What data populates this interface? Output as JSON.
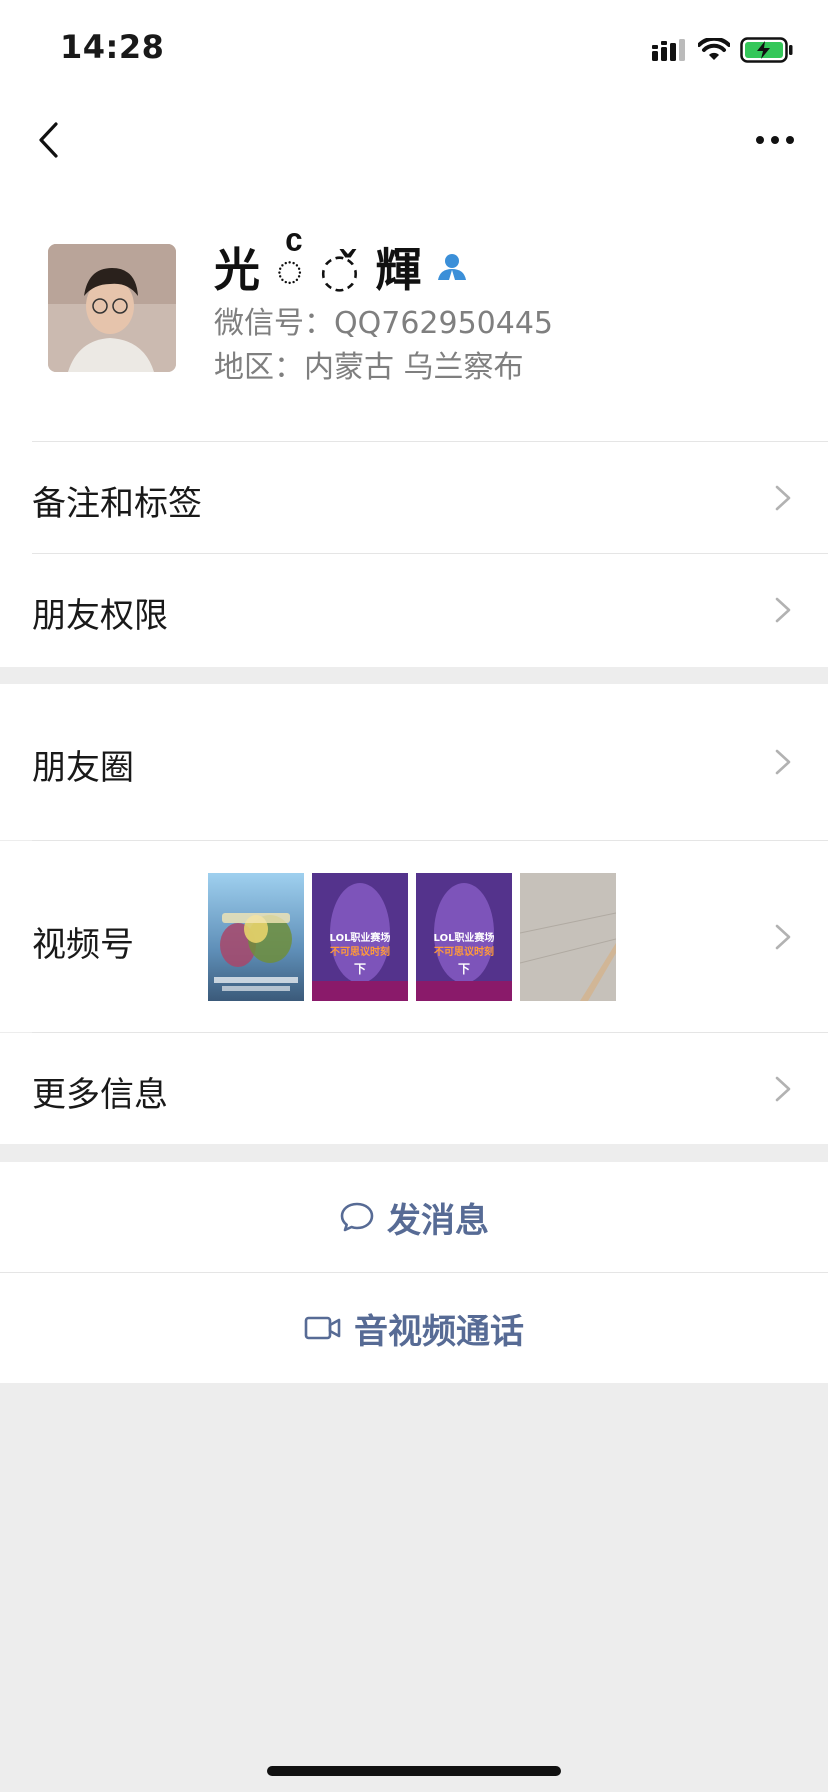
{
  "status_bar": {
    "time": "14:28",
    "battery": "charging"
  },
  "profile": {
    "name": "光 ◌ͨ ◌̌ 輝",
    "wechat_id": "微信号：QQ762950445",
    "region": "地区：内蒙古 乌兰察布"
  },
  "menu": {
    "remark_tags": "备注和标签",
    "friend_permission": "朋友权限",
    "moments": "朋友圈",
    "channels": "视频号",
    "more_info": "更多信息"
  },
  "actions": {
    "send_message": "发消息",
    "av_call": "音视频通话"
  },
  "channels_thumbs": [
    {
      "caption": ""
    },
    {
      "caption": "LOL职业赛场 不可思议时刻 下"
    },
    {
      "caption": "LOL职业赛场 不可思议时刻 下"
    },
    {
      "caption": ""
    }
  ],
  "colors": {
    "link": "#576b95",
    "bg": "#ededed",
    "contact_icon": "#3b8fd8"
  }
}
